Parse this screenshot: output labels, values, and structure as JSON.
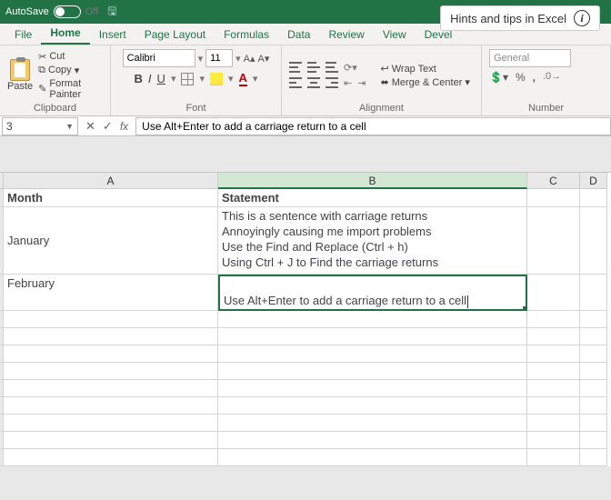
{
  "titlebar": {
    "autosave_label": "AutoSave",
    "autosave_state": "Off"
  },
  "tooltip": {
    "text": "Hints and tips in Excel"
  },
  "tabs": {
    "file": "File",
    "home": "Home",
    "insert": "Insert",
    "page_layout": "Page Layout",
    "formulas": "Formulas",
    "data": "Data",
    "review": "Review",
    "view": "View",
    "developer": "Devel"
  },
  "ribbon": {
    "clipboard": {
      "paste": "Paste",
      "cut": "Cut",
      "copy": "Copy",
      "format_painter": "Format Painter",
      "label": "Clipboard"
    },
    "font": {
      "name": "Calibri",
      "size": "11",
      "label": "Font",
      "bold": "B",
      "italic": "I",
      "underline": "U",
      "font_color_letter": "A"
    },
    "alignment": {
      "label": "Alignment",
      "wrap": "Wrap Text",
      "merge": "Merge & Center"
    },
    "number": {
      "label": "Number",
      "format": "General",
      "percent": "%",
      "comma": ",",
      "currency": "$"
    }
  },
  "formula_bar": {
    "name_box": "3",
    "cancel": "✕",
    "enter": "✓",
    "fx": "fx",
    "content": "Use Alt+Enter to add a carriage return to a cell"
  },
  "columns": {
    "A": "A",
    "B": "B",
    "C": "C",
    "D": "D"
  },
  "sheet": {
    "header": {
      "month": "Month",
      "statement": "Statement"
    },
    "row1": {
      "month": "January",
      "statement": "This is a sentence with carriage returns\nAnnoyingly causing me import problems\nUse the Find and Replace (Ctrl + h)\nUsing Ctrl + J to Find the carriage returns"
    },
    "row2": {
      "month": "February",
      "statement_line2": "Use Alt+Enter to add a carriage return to a cell"
    }
  }
}
